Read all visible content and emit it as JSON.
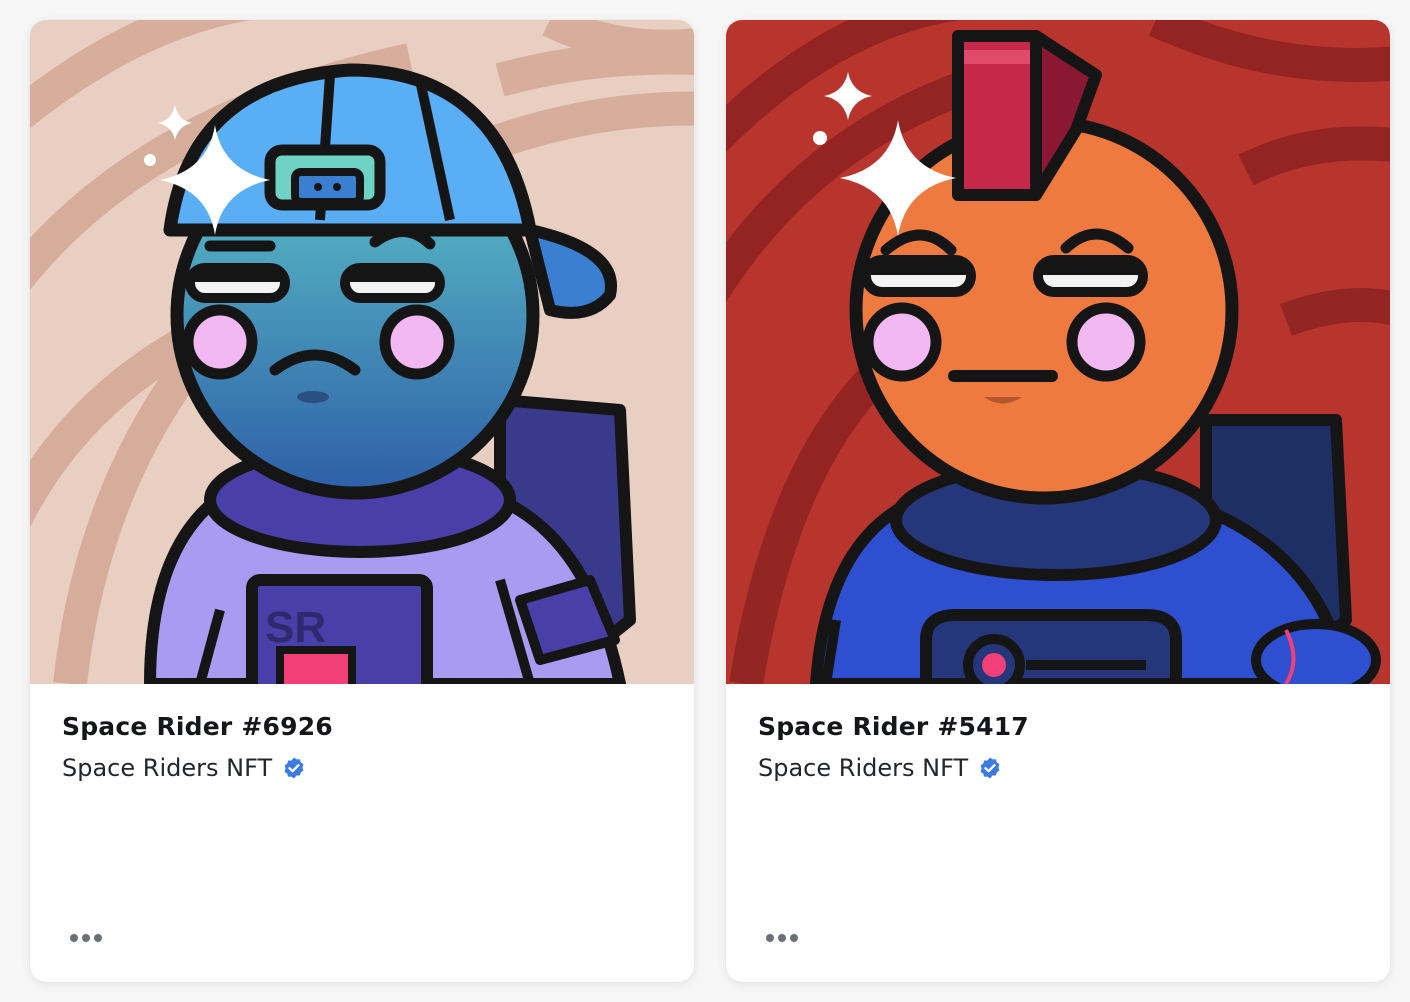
{
  "cards": [
    {
      "title": "Space Rider #6926",
      "collection": "Space Riders NFT",
      "verified_icon": "verified-badge-icon",
      "more_icon": "more-horizontal-icon",
      "art": {
        "background": "#e9cfc2",
        "helmet_suit": "#a99bf2",
        "head": "#3d8fb0",
        "cap": "#5aaef5",
        "badge_text": "SR"
      }
    },
    {
      "title": "Space Rider #5417",
      "collection": "Space Riders NFT",
      "verified_icon": "verified-badge-icon",
      "more_icon": "more-horizontal-icon",
      "art": {
        "background": "#b8352e",
        "suit": "#2e4fd0",
        "head": "#ee7a3f",
        "mohawk": "#c6284a"
      }
    }
  ],
  "colors": {
    "verified": "#3b7be6",
    "title": "#14161a",
    "subtitle": "#23262b",
    "dots": "#6b6f77"
  }
}
